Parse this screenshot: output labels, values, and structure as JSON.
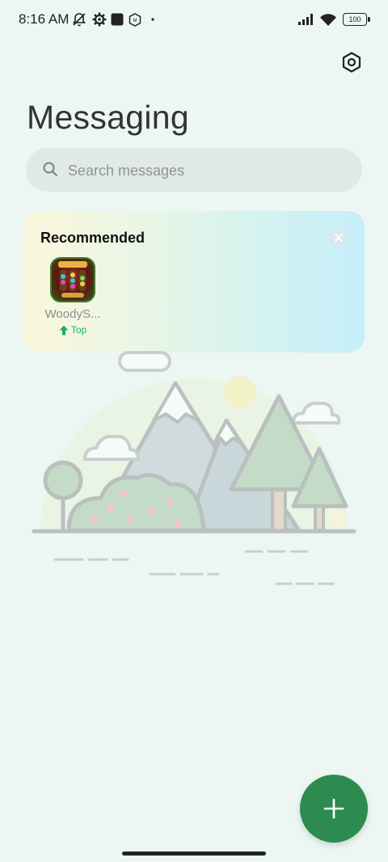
{
  "status_bar": {
    "time": "8:16 AM",
    "battery": "100",
    "icons": [
      "mute-notifications-icon",
      "settings-gear-icon",
      "square-app-icon",
      "shield-app-icon",
      "dot-icon",
      "signal-icon",
      "wifi-icon",
      "battery-icon"
    ]
  },
  "header": {
    "title": "Messaging",
    "settings_icon": "settings-hexagon-icon"
  },
  "search": {
    "placeholder": "Search messages",
    "value": ""
  },
  "recommended": {
    "title": "Recommended",
    "close_icon": "close-icon",
    "apps": [
      {
        "name": "WoodyS...",
        "badge": "Top",
        "badge_icon": "arrow-up-icon"
      }
    ]
  },
  "empty_state": {
    "illustration": "mountain-landscape-illustration"
  },
  "fab": {
    "icon": "plus-icon",
    "color": "#2e8b4f"
  },
  "colors": {
    "background": "#ecf7f3",
    "accent": "#2e8b4f",
    "badge_green": "#19b06a"
  }
}
